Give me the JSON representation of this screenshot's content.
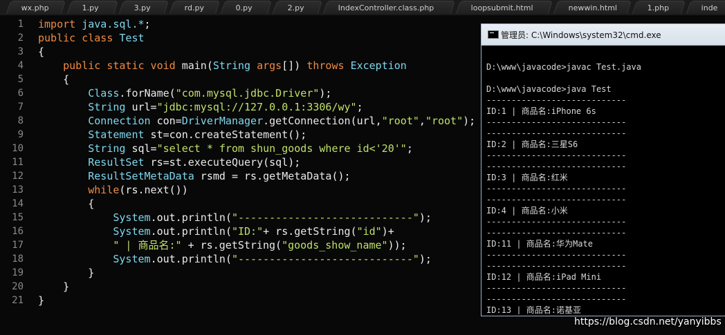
{
  "tabs": [
    "wx.php",
    "1.py",
    "3.py",
    "rd.py",
    "0.py",
    "2.py",
    "IndexController.class.php",
    "loopsubmit.html",
    "newwin.html",
    "1.php",
    "inde"
  ],
  "editor": {
    "line_numbers": [
      "1",
      "2",
      "3",
      "4",
      "5",
      "6",
      "7",
      "8",
      "9",
      "10",
      "11",
      "12",
      "13",
      "14",
      "15",
      "16",
      "17",
      "18",
      "19",
      "20",
      "21"
    ],
    "lines": [
      [
        [
          "kw",
          "import"
        ],
        [
          "plain",
          " "
        ],
        [
          "cls",
          "java.sql.*"
        ],
        [
          "plain",
          ";"
        ]
      ],
      [
        [
          "kw",
          "public class"
        ],
        [
          "plain",
          " "
        ],
        [
          "cls",
          "Test"
        ]
      ],
      [
        [
          "plain",
          "{"
        ]
      ],
      [
        [
          "plain",
          "    "
        ],
        [
          "kw",
          "public static void"
        ],
        [
          "plain",
          " "
        ],
        [
          "fn",
          "main"
        ],
        [
          "plain",
          "("
        ],
        [
          "cls",
          "String"
        ],
        [
          "plain",
          " "
        ],
        [
          "kw",
          "args"
        ],
        [
          "plain",
          "[]) "
        ],
        [
          "kw",
          "throws"
        ],
        [
          "plain",
          " "
        ],
        [
          "cls",
          "Exception"
        ]
      ],
      [
        [
          "plain",
          "    {"
        ]
      ],
      [
        [
          "plain",
          "        "
        ],
        [
          "cls",
          "Class"
        ],
        [
          "plain",
          "."
        ],
        [
          "fn",
          "forName"
        ],
        [
          "plain",
          "("
        ],
        [
          "str",
          "\"com.mysql.jdbc.Driver\""
        ],
        [
          "plain",
          ");"
        ]
      ],
      [
        [
          "plain",
          "        "
        ],
        [
          "cls",
          "String"
        ],
        [
          "plain",
          " url="
        ],
        [
          "str",
          "\"jdbc:mysql://127.0.0.1:3306/wy\""
        ],
        [
          "plain",
          ";"
        ]
      ],
      [
        [
          "plain",
          "        "
        ],
        [
          "cls",
          "Connection"
        ],
        [
          "plain",
          " con="
        ],
        [
          "cls",
          "DriverManager"
        ],
        [
          "plain",
          "."
        ],
        [
          "fn",
          "getConnection"
        ],
        [
          "plain",
          "(url,"
        ],
        [
          "str",
          "\"root\""
        ],
        [
          "plain",
          ","
        ],
        [
          "str",
          "\"root\""
        ],
        [
          "plain",
          ");"
        ]
      ],
      [
        [
          "plain",
          "        "
        ],
        [
          "cls",
          "Statement"
        ],
        [
          "plain",
          " st=con."
        ],
        [
          "fn",
          "createStatement"
        ],
        [
          "plain",
          "();"
        ]
      ],
      [
        [
          "plain",
          "        "
        ],
        [
          "cls",
          "String"
        ],
        [
          "plain",
          " sql="
        ],
        [
          "str",
          "\"select * from shun_goods where id<'20'\""
        ],
        [
          "plain",
          ";"
        ]
      ],
      [
        [
          "plain",
          "        "
        ],
        [
          "cls",
          "ResultSet"
        ],
        [
          "plain",
          " rs=st."
        ],
        [
          "fn",
          "executeQuery"
        ],
        [
          "plain",
          "(sql);"
        ]
      ],
      [
        [
          "plain",
          "        "
        ],
        [
          "cls",
          "ResultSetMetaData"
        ],
        [
          "plain",
          " rsmd = rs."
        ],
        [
          "fn",
          "getMetaData"
        ],
        [
          "plain",
          "();"
        ]
      ],
      [
        [
          "plain",
          "        "
        ],
        [
          "kw",
          "while"
        ],
        [
          "plain",
          "(rs."
        ],
        [
          "fn",
          "next"
        ],
        [
          "plain",
          "())"
        ]
      ],
      [
        [
          "plain",
          "        {"
        ]
      ],
      [
        [
          "plain",
          "            "
        ],
        [
          "cls",
          "System"
        ],
        [
          "plain",
          ".out."
        ],
        [
          "fn",
          "println"
        ],
        [
          "plain",
          "("
        ],
        [
          "str",
          "\"----------------------------\""
        ],
        [
          "plain",
          ");"
        ]
      ],
      [
        [
          "plain",
          "            "
        ],
        [
          "cls",
          "System"
        ],
        [
          "plain",
          ".out."
        ],
        [
          "fn",
          "println"
        ],
        [
          "plain",
          "("
        ],
        [
          "str",
          "\"ID:\""
        ],
        [
          "plain",
          "+ rs."
        ],
        [
          "fn",
          "getString"
        ],
        [
          "plain",
          "("
        ],
        [
          "str",
          "\"id\""
        ],
        [
          "plain",
          ")+"
        ]
      ],
      [
        [
          "plain",
          "            "
        ],
        [
          "str",
          "\" | 商品名:\""
        ],
        [
          "plain",
          " + rs."
        ],
        [
          "fn",
          "getString"
        ],
        [
          "plain",
          "("
        ],
        [
          "str",
          "\"goods_show_name\""
        ],
        [
          "plain",
          "));"
        ]
      ],
      [
        [
          "plain",
          "            "
        ],
        [
          "cls",
          "System"
        ],
        [
          "plain",
          ".out."
        ],
        [
          "fn",
          "println"
        ],
        [
          "plain",
          "("
        ],
        [
          "str",
          "\"----------------------------\""
        ],
        [
          "plain",
          ");"
        ]
      ],
      [
        [
          "plain",
          "        }"
        ]
      ],
      [
        [
          "plain",
          "    }"
        ]
      ],
      [
        [
          "plain",
          "}"
        ]
      ]
    ]
  },
  "cmd": {
    "title": "管理员: C:\\Windows\\system32\\cmd.exe",
    "lines": [
      "",
      "D:\\www\\javacode>javac Test.java",
      "",
      "D:\\www\\javacode>java Test",
      "----------------------------",
      "ID:1 | 商品名:iPhone 6s",
      "----------------------------",
      "----------------------------",
      "ID:2 | 商品名:三星S6",
      "----------------------------",
      "----------------------------",
      "ID:3 | 商品名:红米",
      "----------------------------",
      "----------------------------",
      "ID:4 | 商品名:小米",
      "----------------------------",
      "----------------------------",
      "ID:11 | 商品名:华为Mate",
      "----------------------------",
      "----------------------------",
      "ID:12 | 商品名:iPad Mini",
      "----------------------------",
      "----------------------------",
      "ID:13 | 商品名:诺基亚"
    ]
  },
  "watermark": "https://blog.csdn.net/yanyibbs"
}
